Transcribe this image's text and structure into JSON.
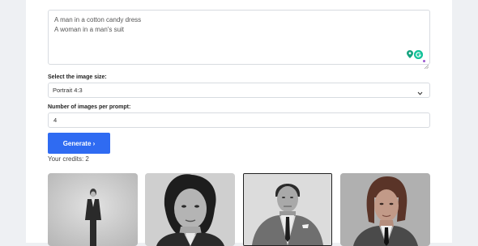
{
  "prompt": {
    "lines": [
      "A man in a cotton candy dress",
      "A woman in a man's suit"
    ]
  },
  "image_size": {
    "label": "Select the image size:",
    "selected": "Portrait 4:3"
  },
  "images_per_prompt": {
    "label": "Number of images per prompt:",
    "value": "4"
  },
  "generate_button": "Generate ›",
  "credits": "Your credits: 2",
  "colors": {
    "accent": "#2f6bf2",
    "grammarly": "#15c39a"
  },
  "icons": [
    "location-pin-icon",
    "grammarly-icon",
    "chevron-down-icon",
    "resize-handle-icon"
  ]
}
